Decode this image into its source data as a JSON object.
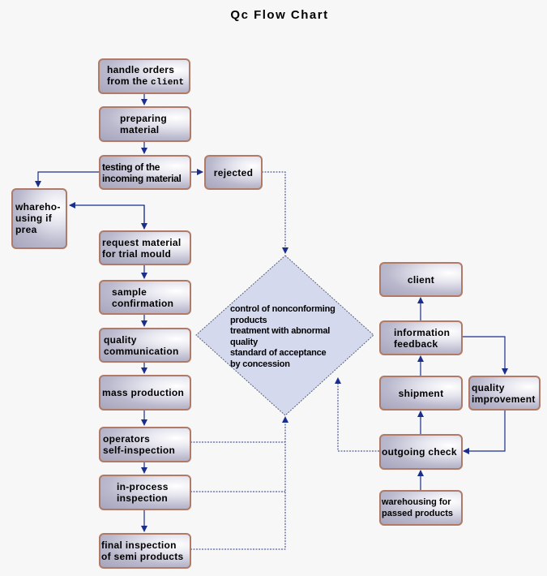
{
  "title": "Qc Flow Chart",
  "nodes": {
    "handle_orders": {
      "line1": "handle orders",
      "line2_prefix": "from the ",
      "line2_suffix": "client"
    },
    "preparing_material": "preparing\nmaterial",
    "testing_incoming": "testing of the\nincoming material",
    "rejected": "rejected",
    "warehousing_if_prea": "whareho-\nusing if\nprea",
    "request_material": "request material\nfor trial mould",
    "sample_confirmation": "sample\nconfirmation",
    "quality_communication": "quality\ncommunication",
    "mass_production": "mass production",
    "operators_self_inspection": "operators\nself-inspection",
    "in_process_inspection": "in-process\ninspection",
    "final_inspection": "final inspection\nof semi products",
    "nonconforming_control": "control of nonconforming\nproducts\ntreatment with  abnormal\nquality\nstandard of acceptance\nby concession",
    "client": "client",
    "information_feedback": "information\nfeedback",
    "shipment": "shipment",
    "quality_improvement": "quality\nimprovement",
    "outgoing_check": "outgoing check",
    "warehousing_passed": "warehousing for\npassed products"
  },
  "colors": {
    "box_border": "#b07a66",
    "solid_arrow": "#1a2e8c",
    "dotted_arrow": "#2b3a8a",
    "diamond_fill": "#d5d9ee"
  }
}
